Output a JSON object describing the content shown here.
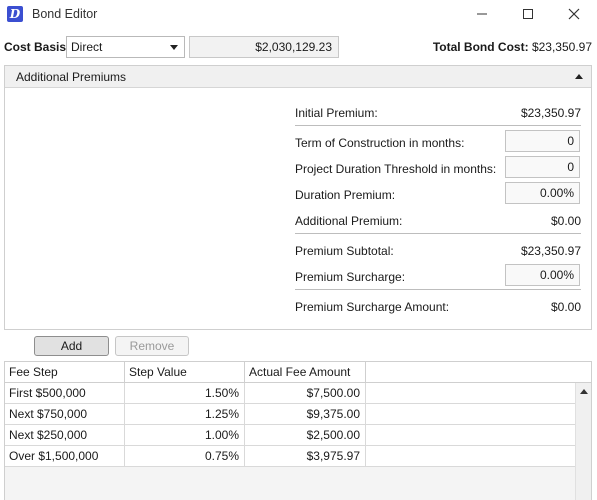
{
  "window": {
    "title": "Bond Editor",
    "icon_letter": "D",
    "minimize_glyph": "—",
    "maximize_glyph": "☐",
    "close_glyph": "✕"
  },
  "cost_basis": {
    "label": "Cost Basis:",
    "selected": "Direct",
    "amount": "$2,030,129.23"
  },
  "total": {
    "label": "Total Bond Cost:",
    "value": "$23,350.97"
  },
  "premiums": {
    "title": "Additional Premiums",
    "initial_label": "Initial Premium:",
    "initial_value": "$23,350.97",
    "term_label": "Term of Construction in months:",
    "term_value": "0",
    "threshold_label": "Project Duration Threshold in months:",
    "threshold_value": "0",
    "duration_label": "Duration Premium:",
    "duration_value": "0.00%",
    "additional_label": "Additional Premium:",
    "additional_value": "$0.00",
    "subtotal_label": "Premium Subtotal:",
    "subtotal_value": "$23,350.97",
    "surcharge_label": "Premium Surcharge:",
    "surcharge_value": "0.00%",
    "surcharge_amount_label": "Premium Surcharge Amount:",
    "surcharge_amount_value": "$0.00"
  },
  "actions": {
    "add": "Add",
    "remove": "Remove"
  },
  "fee_table": {
    "columns": [
      "Fee Step",
      "Step Value",
      "Actual Fee Amount"
    ],
    "rows": [
      {
        "step": "First $500,000",
        "value": "1.50%",
        "amount": "$7,500.00"
      },
      {
        "step": "Next $750,000",
        "value": "1.25%",
        "amount": "$9,375.00"
      },
      {
        "step": "Next $250,000",
        "value": "1.00%",
        "amount": "$2,500.00"
      },
      {
        "step": "Over $1,500,000",
        "value": "0.75%",
        "amount": "$3,975.97"
      }
    ]
  },
  "colors": {
    "accent": "#3b4fd1",
    "panel_header": "#f0f0f0",
    "button_face": "#e1e1e1"
  },
  "icons": [
    "app-logo-icon",
    "minimize-icon",
    "maximize-icon",
    "close-icon",
    "dropdown-caret-icon",
    "collapse-chevron-icon",
    "scroll-up-icon"
  ]
}
